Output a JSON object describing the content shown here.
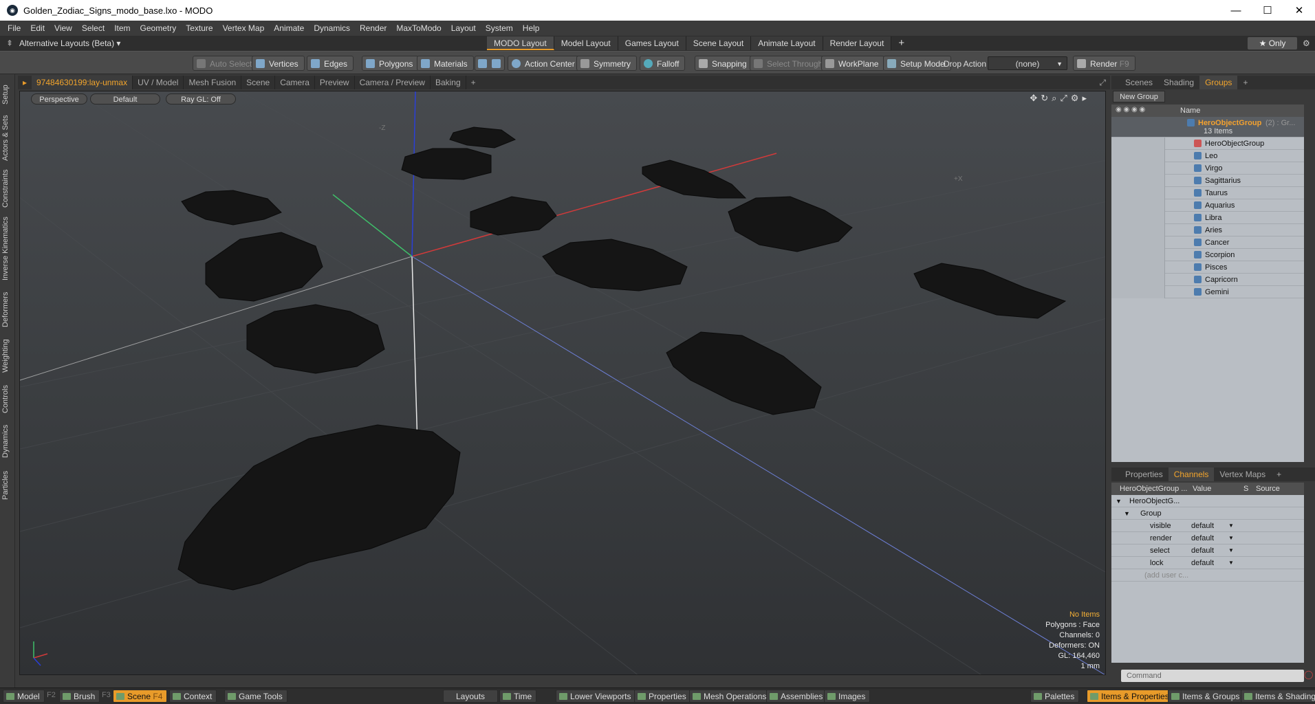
{
  "window": {
    "title": "Golden_Zodiac_Signs_modo_base.lxo - MODO",
    "minimize": "—",
    "maximize": "☐",
    "close": "✕"
  },
  "menu": [
    "File",
    "Edit",
    "View",
    "Select",
    "Item",
    "Geometry",
    "Texture",
    "Vertex Map",
    "Animate",
    "Dynamics",
    "Render",
    "MaxToModo",
    "Layout",
    "System",
    "Help"
  ],
  "layoutbar": {
    "alt_layouts": "Alternative Layouts (Beta) ▾",
    "tabs": [
      "MODO Layout",
      "Model Layout",
      "Games Layout",
      "Scene Layout",
      "Animate Layout",
      "Render Layout"
    ],
    "add": "+",
    "only": "★ Only"
  },
  "toolbar": {
    "auto_select": "Auto Select",
    "vertices": "Vertices",
    "edges": "Edges",
    "polygons": "Polygons",
    "materials": "Materials",
    "action_center": "Action Center",
    "symmetry": "Symmetry",
    "falloff": "Falloff",
    "snapping": "Snapping",
    "select_through": "Select Through",
    "workplane": "WorkPlane",
    "setup_mode": "Setup Mode",
    "drop_action_label": "Drop Action",
    "drop_action_value": "(none)",
    "render": "Render",
    "render_key": "F9"
  },
  "left_tabs": [
    "Setup",
    "Actors & Sets",
    "Constraints",
    "Inverse Kinematics",
    "Deformers",
    "Weighting",
    "Controls",
    "Dynamics",
    "Particles"
  ],
  "viewport_tabs": [
    "97484630199:lay-unmax",
    "UV / Model",
    "Mesh Fusion",
    "Scene",
    "Camera",
    "Preview",
    "Camera / Preview",
    "Baking",
    "+"
  ],
  "viewport": {
    "perspective": "Perspective",
    "default": "Default",
    "raygl": "Ray GL: Off",
    "axis_label_neg_z": "-Z",
    "axis_label_pos_x": "+X",
    "info": {
      "items": "No Items",
      "polygons": "Polygons : Face",
      "channels": "Channels: 0",
      "deformers": "Deformers: ON",
      "gl": "GL: 164,460",
      "unit": "1 mm"
    }
  },
  "groups_panel": {
    "tabs": [
      "Scenes",
      "Shading",
      "Groups",
      "+"
    ],
    "new_group": "New Group",
    "name_header": "Name",
    "group_name": "HeroObjectGroup",
    "group_suffix": "(2) : Gr...",
    "item_count": "13 Items",
    "items": [
      "HeroObjectGroup",
      "Leo",
      "Virgo",
      "Sagittarius",
      "Taurus",
      "Aquarius",
      "Libra",
      "Aries",
      "Cancer",
      "Scorpion",
      "Pisces",
      "Capricorn",
      "Gemini"
    ]
  },
  "channels_panel": {
    "tabs": [
      "Properties",
      "Channels",
      "Vertex Maps",
      "+"
    ],
    "col_name": "HeroObjectGroup ...",
    "col_value": "Value",
    "col_s": "S",
    "col_source": "Source",
    "root": "HeroObjectG...",
    "group": "Group",
    "rows": [
      {
        "name": "visible",
        "value": "default"
      },
      {
        "name": "render",
        "value": "default"
      },
      {
        "name": "select",
        "value": "default"
      },
      {
        "name": "lock",
        "value": "default"
      }
    ],
    "add_user": "(add user c..."
  },
  "command": {
    "placeholder": "Command"
  },
  "statusbar": {
    "model": "Model",
    "model_key": "F2",
    "brush": "Brush",
    "brush_key": "F3",
    "scene": "Scene",
    "scene_key": "F4",
    "context": "Context",
    "game_tools": "Game Tools",
    "layouts": "Layouts",
    "time": "Time",
    "lower_viewports": "Lower Viewports",
    "properties": "Properties",
    "mesh_operations": "Mesh Operations",
    "assemblies": "Assemblies",
    "images": "Images",
    "palettes": "Palettes",
    "items_properties": "Items & Properties",
    "items_groups": "Items & Groups",
    "items_shading": "Items & Shading"
  },
  "colors": {
    "accent": "#e89b2a",
    "x_axis": "#d33a3a",
    "y_axis": "#2a3fd8",
    "z_axis": "#3fbf6a"
  }
}
